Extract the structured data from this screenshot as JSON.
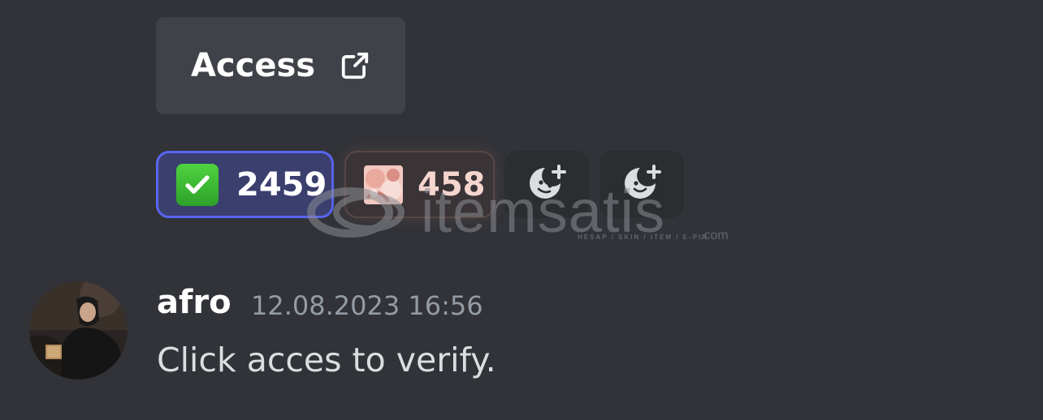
{
  "button": {
    "label": "Access",
    "icon": "external-link-icon"
  },
  "reactions": [
    {
      "emoji": "white-check-mark-icon",
      "count": "2459",
      "selected": true
    },
    {
      "emoji": "custom-emoji-image",
      "count": "458",
      "selected": false
    }
  ],
  "add_reaction_buttons": [
    {
      "icon": "add-reaction-icon"
    },
    {
      "icon": "add-reaction-icon"
    }
  ],
  "watermark": {
    "brand": "itemsatis",
    "tagline": "HESAP / SKIN / ITEM / E-PIN",
    "suffix": ".com"
  },
  "message": {
    "username": "afro",
    "timestamp": "12.08.2023 16:56",
    "text": "Click acces to verify."
  },
  "colors": {
    "background": "#313338",
    "button": "#404249",
    "accent": "#5865f2",
    "text": "#dbdee1",
    "muted": "#949ba4"
  }
}
